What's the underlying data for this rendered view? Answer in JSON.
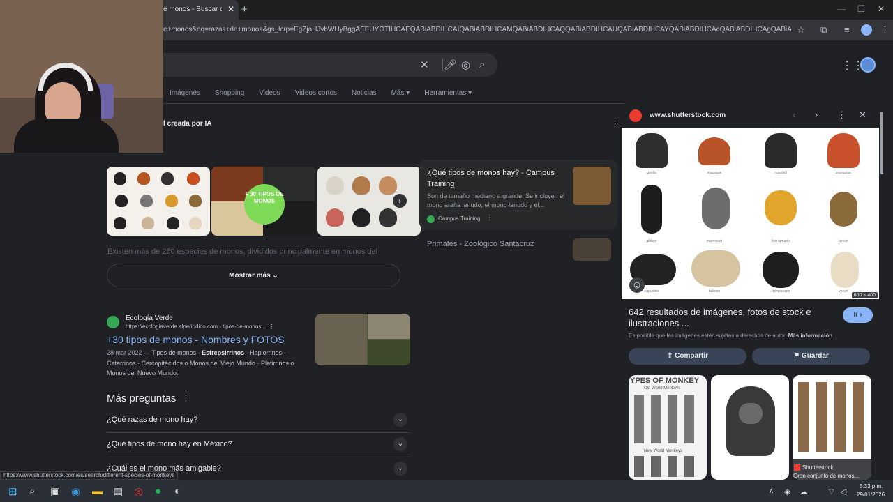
{
  "browser": {
    "tab_title": "e monos - Buscar con G",
    "url": "e+monos&oq=razas+de+monos&gs_lcrp=EgZjaHJvbWUyBggAEEUYOTIHCAEQABiABDIHCAIQABiABDIHCAMQABiABDIHCAQQABiABDIHCAUQABiABDIHCAYQABiABDIHCAcQABiABDIHCAgQABiABDIHCAkQABiABNIBC..."
  },
  "search": {
    "tabs": [
      "Imágenes",
      "Shopping",
      "Videos",
      "Videos cortos",
      "Noticias",
      "Más ▾",
      "Herramientas ▾"
    ]
  },
  "ai_overview": {
    "label": "l creada por IA",
    "badge_text": "+ 30 TIPOS DE MONOS",
    "fade_text": "Existen más de 260 especies de monos, divididos principalmente en monos del",
    "show_more": "Mostrar más"
  },
  "cards": [
    {
      "title": "¿Qué tipos de monos hay? - Campus Training",
      "snippet": "Son de tamaño mediano a grande. Se incluyen el mono araña lanudo, el mono lanudo y el...",
      "source": "Campus Training"
    },
    {
      "title": "Primates - Zoológico Santacruz"
    }
  ],
  "result": {
    "site": "Ecología Verde",
    "url": "https://ecologiaverde.elperiodico.com › tipos-de-monos...",
    "title": "+30 tipos de monos - Nombres y FOTOS",
    "date": "28 mar 2022 —",
    "snippet_pre": "Tipos de monos ·",
    "snippet_bold": "Estrepsirrinos",
    "snippet_post": "· Haplorrinos · Catarrinos · Cercopitécidos o Monos del Viejo Mundo · Platirrinos o Monos del Nuevo Mundo."
  },
  "paa": {
    "title": "Más preguntas",
    "questions": [
      "¿Qué razas de mono hay?",
      "¿Qué tipos de mono hay en México?",
      "¿Cuál es el mono más amigable?"
    ]
  },
  "panel": {
    "domain": "www.shutterstock.com",
    "image_dims": "600 × 400",
    "monkey_labels": [
      "gorilla",
      "macaque",
      "mandrill",
      "orangutan",
      "gibbon",
      "marmoset",
      "lion tamarin",
      "tarsier",
      "capuchin",
      "baboon",
      "chimpanzee",
      "vervet"
    ],
    "description": "642 resultados de imágenes, fotos de stock e ilustraciones ...",
    "go_label": "Ir",
    "copyright": "Es posible que las imágenes estén sujetas a derechos de autor.",
    "more_info": "Más información",
    "share_label": "Compartir",
    "save_label": "Guardar",
    "related": {
      "card1_head": "YPES OF MONKEY",
      "card1_sub1": "Old World Monkeys",
      "card1_sub2": "New World Monkeys",
      "card3_source": "Shutterstock",
      "card3_caption": "Gran conjunto de monos..."
    }
  },
  "status_url": "https://www.shutterstock.com/es/search/different-species-of-monkeys",
  "clock": {
    "time": "5:33 p.m.",
    "date": "29/01/2026"
  }
}
